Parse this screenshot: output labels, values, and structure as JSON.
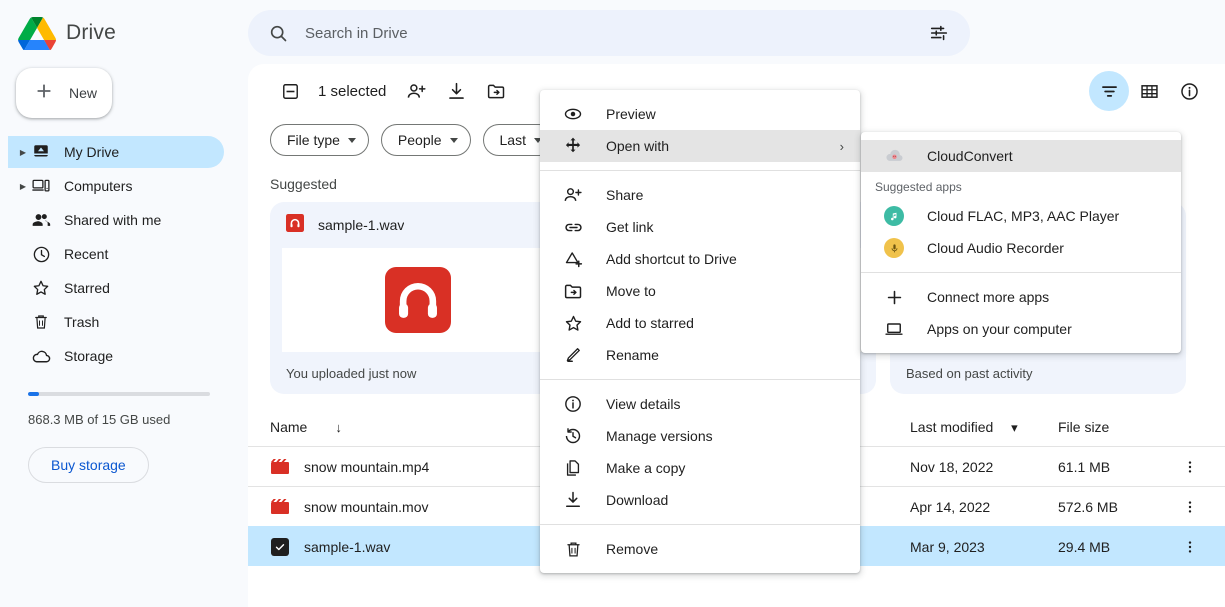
{
  "brand": {
    "name": "Drive"
  },
  "sidebar": {
    "new_button": {
      "label": "New",
      "icon": "plus-icon"
    },
    "items": [
      {
        "label": "My Drive",
        "icon": "my-drive-icon",
        "active": true,
        "expandable": true
      },
      {
        "label": "Computers",
        "icon": "computers-icon",
        "active": false,
        "expandable": true
      },
      {
        "label": "Shared with me",
        "icon": "shared-with-me-icon",
        "active": false,
        "expandable": false
      },
      {
        "label": "Recent",
        "icon": "clock-icon",
        "active": false,
        "expandable": false
      },
      {
        "label": "Starred",
        "icon": "star-icon",
        "active": false,
        "expandable": false
      },
      {
        "label": "Trash",
        "icon": "trash-icon",
        "active": false,
        "expandable": false
      },
      {
        "label": "Storage",
        "icon": "cloud-icon",
        "active": false,
        "expandable": false
      }
    ],
    "storage": {
      "text": "868.3 MB of 15 GB used",
      "percent": 6,
      "bar_color": "#1a73e8",
      "buy_label": "Buy storage"
    }
  },
  "search": {
    "placeholder": "Search in Drive",
    "value": "",
    "icon": "search-icon",
    "options_icon": "search-options-icon"
  },
  "toolbar": {
    "selection_label": "1 selected",
    "clear_icon": "indeterminate-checkbox-icon",
    "actions": [
      {
        "icon": "person-add-icon",
        "name": "share-button"
      },
      {
        "icon": "download-icon",
        "name": "download-button"
      },
      {
        "icon": "move-folder-icon",
        "name": "move-button"
      }
    ],
    "right_actions": [
      {
        "icon": "filter-icon",
        "name": "filter-toggle-button",
        "active": true
      },
      {
        "icon": "grid-view-icon",
        "name": "grid-view-button",
        "active": false
      },
      {
        "icon": "info-icon",
        "name": "details-button",
        "active": false
      }
    ]
  },
  "filters": [
    {
      "label": "File type"
    },
    {
      "label": "People"
    },
    {
      "label": "Last"
    }
  ],
  "suggested": {
    "title": "Suggested",
    "cards": [
      {
        "name": "sample-1.wav",
        "footer": "You uploaded just now",
        "icon": "audio-file-icon"
      },
      {
        "name": "",
        "footer": "",
        "icon": ""
      },
      {
        "name": "",
        "footer": "Based on past activity",
        "icon": ""
      }
    ]
  },
  "table": {
    "columns": [
      {
        "label": "Name",
        "sort_icon": "sort-down-arrow"
      },
      {
        "label": "Last modified",
        "sort_icon": "caret-down"
      },
      {
        "label": "File size",
        "sort_icon": ""
      }
    ],
    "rows": [
      {
        "name": "snow mountain.mp4",
        "modified": "Nov 18, 2022",
        "size": "61.1 MB",
        "icon": "video-file-icon",
        "selected": false
      },
      {
        "name": "snow mountain.mov",
        "modified": "Apr 14, 2022",
        "size": "572.6 MB",
        "icon": "video-file-icon",
        "selected": false
      },
      {
        "name": "sample-1.wav",
        "modified": "Mar 9, 2023",
        "size": "29.4 MB",
        "icon": "checkbox-checked",
        "selected": true
      }
    ],
    "more_icon": "more-vert-icon"
  },
  "context_menu": {
    "groups": [
      [
        {
          "label": "Preview",
          "icon": "eye-icon",
          "highlighted": false,
          "submenu": false
        },
        {
          "label": "Open with",
          "icon": "open-with-icon",
          "highlighted": true,
          "submenu": true,
          "arrow": "›"
        }
      ],
      [
        {
          "label": "Share",
          "icon": "person-add-icon",
          "highlighted": false,
          "submenu": false
        },
        {
          "label": "Get link",
          "icon": "link-icon",
          "highlighted": false,
          "submenu": false
        },
        {
          "label": "Add shortcut to Drive",
          "icon": "add-shortcut-icon",
          "highlighted": false,
          "submenu": false
        },
        {
          "label": "Move to",
          "icon": "move-folder-icon",
          "highlighted": false,
          "submenu": false
        },
        {
          "label": "Add to starred",
          "icon": "star-icon",
          "highlighted": false,
          "submenu": false
        },
        {
          "label": "Rename",
          "icon": "pencil-icon",
          "highlighted": false,
          "submenu": false
        }
      ],
      [
        {
          "label": "View details",
          "icon": "info-icon",
          "highlighted": false,
          "submenu": false
        },
        {
          "label": "Manage versions",
          "icon": "manage-versions-icon",
          "highlighted": false,
          "submenu": false
        },
        {
          "label": "Make a copy",
          "icon": "copy-icon",
          "highlighted": false,
          "submenu": false
        },
        {
          "label": "Download",
          "icon": "download-icon",
          "highlighted": false,
          "submenu": false
        }
      ],
      [
        {
          "label": "Remove",
          "icon": "trash-icon",
          "highlighted": false,
          "submenu": false
        }
      ]
    ]
  },
  "open_with_submenu": {
    "primary": {
      "label": "CloudConvert",
      "icon": "cloudconvert-icon",
      "highlighted": true
    },
    "suggested_header": "Suggested apps",
    "suggested_apps": [
      {
        "label": "Cloud FLAC, MP3, AAC Player",
        "icon": "music-note-icon",
        "color": "#3dbba4"
      },
      {
        "label": "Cloud Audio Recorder",
        "icon": "microphone-icon",
        "color": "#f0c24b"
      }
    ],
    "footer_items": [
      {
        "label": "Connect more apps",
        "icon": "plus-icon"
      },
      {
        "label": "Apps on your computer",
        "icon": "laptop-icon"
      }
    ]
  },
  "colors": {
    "accent_blue": "#1a73e8",
    "selection_blue": "#c2e7ff",
    "link_blue": "#0b57d0",
    "audio_red": "#d93025",
    "page_bg": "#f8fafd"
  }
}
